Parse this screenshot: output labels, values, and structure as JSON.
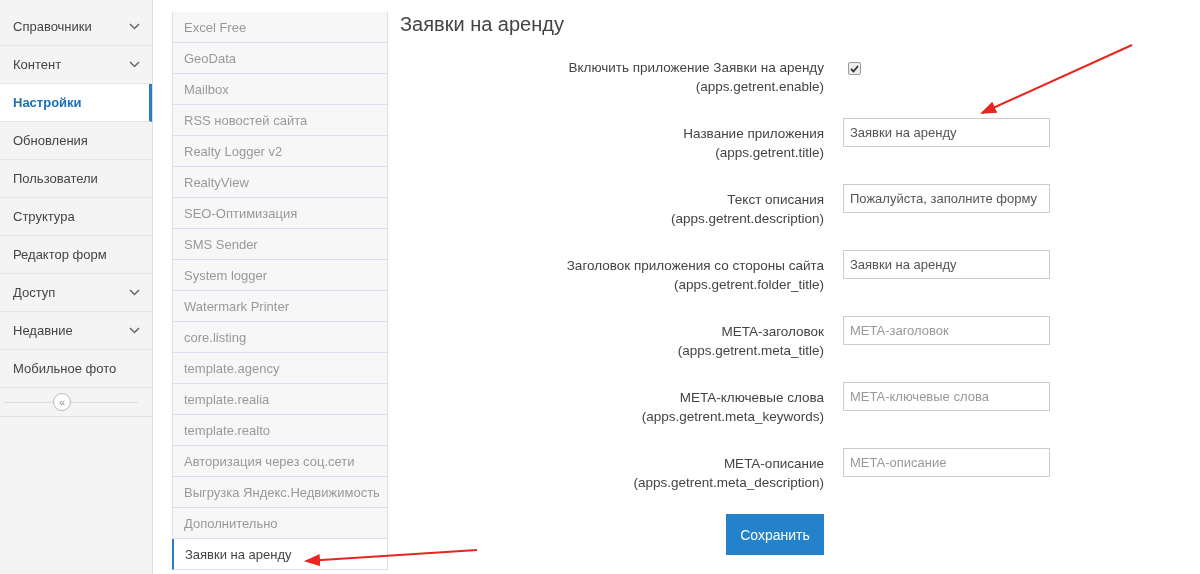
{
  "sidebar": {
    "items": [
      {
        "label": "Справочники",
        "expandable": true,
        "selected": false
      },
      {
        "label": "Контент",
        "expandable": true,
        "selected": false
      },
      {
        "label": "Настройки",
        "expandable": false,
        "selected": true
      },
      {
        "label": "Обновления",
        "expandable": false,
        "selected": false
      },
      {
        "label": "Пользователи",
        "expandable": false,
        "selected": false
      },
      {
        "label": "Структура",
        "expandable": false,
        "selected": false
      },
      {
        "label": "Редактор форм",
        "expandable": false,
        "selected": false
      },
      {
        "label": "Доступ",
        "expandable": true,
        "selected": false
      },
      {
        "label": "Недавние",
        "expandable": true,
        "selected": false
      },
      {
        "label": "Мобильное фото",
        "expandable": false,
        "selected": false
      }
    ],
    "collapse_button": "«"
  },
  "modules": [
    {
      "label": "Excel Free",
      "selected": false
    },
    {
      "label": "GeoData",
      "selected": false
    },
    {
      "label": "Mailbox",
      "selected": false
    },
    {
      "label": "RSS новостей сайта",
      "selected": false
    },
    {
      "label": "Realty Logger v2",
      "selected": false
    },
    {
      "label": "RealtyView",
      "selected": false
    },
    {
      "label": "SEO-Оптимизация",
      "selected": false
    },
    {
      "label": "SMS Sender",
      "selected": false
    },
    {
      "label": "System logger",
      "selected": false
    },
    {
      "label": "Watermark Printer",
      "selected": false
    },
    {
      "label": "core.listing",
      "selected": false
    },
    {
      "label": "template.agency",
      "selected": false
    },
    {
      "label": "template.realia",
      "selected": false
    },
    {
      "label": "template.realto",
      "selected": false
    },
    {
      "label": "Авторизация через соц.сети",
      "selected": false
    },
    {
      "label": "Выгрузка Яндекс.Недвижимость",
      "selected": false
    },
    {
      "label": "Дополнительно",
      "selected": false
    },
    {
      "label": "Заявки на аренду",
      "selected": true
    }
  ],
  "form": {
    "title": "Заявки на аренду",
    "fields": [
      {
        "kind": "checkbox",
        "label": "Включить приложение Заявки на аренду",
        "key": "(apps.getrent.enable)",
        "checked": true
      },
      {
        "kind": "text",
        "label": "Название приложения",
        "key": "(apps.getrent.title)",
        "value": "Заявки на аренду"
      },
      {
        "kind": "text",
        "label": "Текст описания",
        "key": "(apps.getrent.description)",
        "value": "Пожалуйста, заполните форму"
      },
      {
        "kind": "text",
        "label": "Заголовок приложения со стороны сайта",
        "key": "(apps.getrent.folder_title)",
        "value": "Заявки на аренду"
      },
      {
        "kind": "text",
        "label": "META-заголовок",
        "key": "(apps.getrent.meta_title)",
        "placeholder": "META-заголовок"
      },
      {
        "kind": "text",
        "label": "META-ключевые слова",
        "key": "(apps.getrent.meta_keywords)",
        "placeholder": "META-ключевые слова"
      },
      {
        "kind": "text",
        "label": "META-описание",
        "key": "(apps.getrent.meta_description)",
        "placeholder": "META-описание"
      }
    ],
    "save_button": "Сохранить"
  }
}
